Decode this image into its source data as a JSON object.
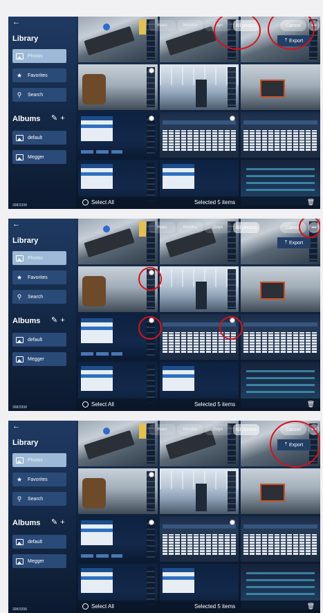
{
  "app": {
    "back_icon": "back-arrow-icon",
    "library_title": "Library",
    "albums_title": "Albums",
    "albums_actions": "✎ +",
    "nav": {
      "photos": "Photos",
      "favorites": "Favorites",
      "search": "Search",
      "default": "default",
      "megger": "Megger"
    },
    "counter": "398/3398",
    "segments": [
      "Years",
      "Months",
      "Days",
      "All photos"
    ],
    "cancel": "Cancel",
    "more": "•••",
    "export": "Export",
    "select_all": "Select All",
    "selected": "Selected 5 items",
    "trash_icon": "trash-icon"
  },
  "steps": [
    {
      "annotations": [
        "All photos",
        "Cancel"
      ]
    },
    {
      "annotations": [
        "more-button",
        "thumbnail-selection"
      ]
    },
    {
      "annotations": [
        "Export"
      ]
    }
  ],
  "colors": {
    "highlight": "#d8111b",
    "sidebar_active": "#9cbad7",
    "sidebar_item": "#2a4a78"
  }
}
